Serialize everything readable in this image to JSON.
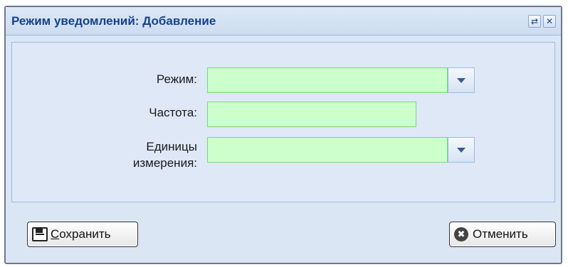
{
  "window": {
    "title": "Режим уведомлений: Добавление",
    "refresh_icon": "refresh-icon",
    "close_icon": "close-icon",
    "refresh_glyph": "⇄",
    "close_glyph": "✕"
  },
  "form": {
    "mode": {
      "label": "Режим:",
      "value": ""
    },
    "frequency": {
      "label": "Частота:",
      "value": ""
    },
    "units": {
      "label": "Единицы\nизмерения:",
      "value": ""
    }
  },
  "footer": {
    "save_label": "Сохранить",
    "cancel_label": "Отменить",
    "cancel_glyph": "✖",
    "save_icon": "floppy-disk-icon",
    "cancel_icon": "cancel-icon"
  },
  "colors": {
    "title": "#15428b",
    "field_bg": "#ccffcc",
    "field_border": "#7fd37f",
    "panel_bg": "#dfe8f6"
  }
}
